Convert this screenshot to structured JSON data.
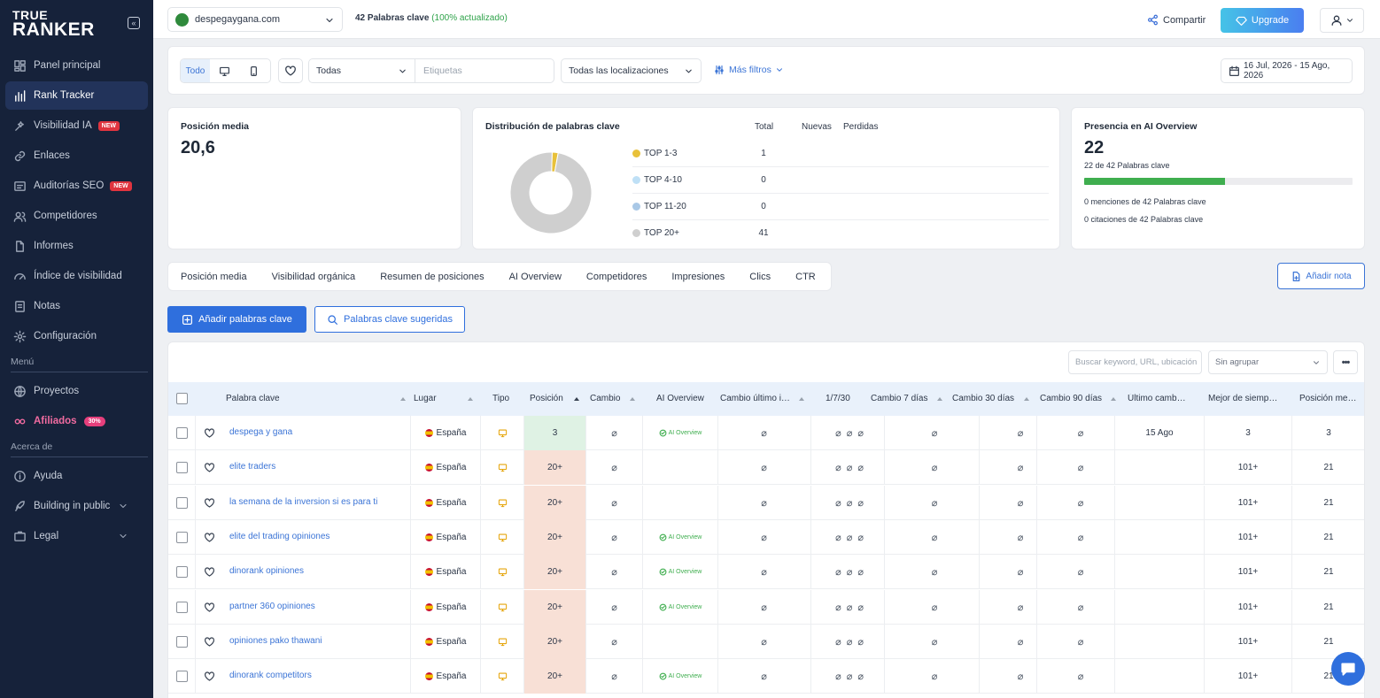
{
  "brand": {
    "line1": "TRUE",
    "line2": "RANKER"
  },
  "sidebar": {
    "items": [
      {
        "label": "Panel principal",
        "icon": "dashboard-icon"
      },
      {
        "label": "Rank Tracker",
        "icon": "bar-chart-icon",
        "active": true
      },
      {
        "label": "Visibilidad IA",
        "icon": "sparkle-icon",
        "badge": "NEW"
      },
      {
        "label": "Enlaces",
        "icon": "link-icon"
      },
      {
        "label": "Auditorías SEO",
        "icon": "audit-icon",
        "badge": "NEW"
      },
      {
        "label": "Competidores",
        "icon": "users-icon"
      },
      {
        "label": "Informes",
        "icon": "file-icon"
      },
      {
        "label": "Índice de visibilidad",
        "icon": "gauge-icon"
      },
      {
        "label": "Notas",
        "icon": "note-icon"
      },
      {
        "label": "Configuración",
        "icon": "gear-icon"
      }
    ],
    "menu_label": "Menú",
    "menu_items": [
      {
        "label": "Proyectos",
        "icon": "globe-icon"
      },
      {
        "label": "Afiliados",
        "icon": "affiliate-icon",
        "badge": "30%"
      }
    ],
    "about_label": "Acerca de",
    "about_items": [
      {
        "label": "Ayuda",
        "icon": "info-icon"
      },
      {
        "label": "Building in public",
        "icon": "rocket-icon"
      },
      {
        "label": "Legal",
        "icon": "legal-icon"
      }
    ]
  },
  "topbar": {
    "domain": "despegaygana.com",
    "keywords_count": "42 Palabras clave",
    "keywords_status": "(100% actualizado)",
    "share_label": "Compartir",
    "upgrade_label": "Upgrade"
  },
  "filters": {
    "device_all": "Todo",
    "group_select": "Todas",
    "tags_placeholder": "Etiquetas",
    "location_select": "Todas las localizaciones",
    "more_filters": "Más filtros",
    "date_range": "16 Jul, 2026 - 15 Ago, 2026"
  },
  "avg_position": {
    "title": "Posición media",
    "value": "20,6"
  },
  "distribution": {
    "title": "Distribución de palabras clave",
    "headers": [
      "Total",
      "Nuevas",
      "Perdidas"
    ],
    "rows": [
      {
        "label": "TOP 1-3",
        "total": "1",
        "color": "#e8c13a"
      },
      {
        "label": "TOP 4-10",
        "total": "0",
        "color": "#bfe0f6"
      },
      {
        "label": "TOP 11-20",
        "total": "0",
        "color": "#a9c8e6"
      },
      {
        "label": "TOP 20+",
        "total": "41",
        "color": "#cfcfcf"
      }
    ]
  },
  "chart_data": {
    "type": "pie",
    "title": "Distribución de palabras clave",
    "categories": [
      "TOP 1-3",
      "TOP 4-10",
      "TOP 11-20",
      "TOP 20+"
    ],
    "values": [
      1,
      0,
      0,
      41
    ],
    "colors": [
      "#e8c13a",
      "#bfe0f6",
      "#a9c8e6",
      "#cfcfcf"
    ]
  },
  "ai_presence": {
    "title": "Presencia en AI Overview",
    "value": "22",
    "subtitle": "22 de 42 Palabras clave",
    "fraction": 0.524,
    "mentions": "0 menciones de 42 Palabras clave",
    "citations": "0 citaciones de 42 Palabras clave"
  },
  "tabs": [
    "Posición media",
    "Visibilidad orgánica",
    "Resumen de posiciones",
    "AI Overview",
    "Competidores",
    "Impresiones",
    "Clics",
    "CTR"
  ],
  "actions": {
    "add_note": "Añadir nota",
    "add_keywords": "Añadir palabras clave",
    "suggested_keywords": "Palabras clave sugeridas"
  },
  "table": {
    "search_placeholder": "Buscar keyword, URL, ubicación",
    "group_placeholder": "Sin agrupar",
    "more": "•••",
    "columns": [
      "Palabra clave",
      "Lugar",
      "Tipo",
      "Posición",
      "Cambio",
      "AI Overview",
      "Cambio último i…",
      "1/7/30",
      "Cambio 7 días",
      "Cambio 30 días",
      "Cambio 90 días",
      "Último camb…",
      "Mejor de siemp…",
      "Posición me…"
    ],
    "null_glyph": "⌀",
    "ai_label": "AI Overview",
    "rows": [
      {
        "keyword": "despega y gana",
        "place": "España",
        "position": "3",
        "ai": true,
        "last_change": "15 Ago",
        "best": "3",
        "avg": "3"
      },
      {
        "keyword": "elite traders",
        "place": "España",
        "position": "20+",
        "ai": false,
        "last_change": "",
        "best": "101+",
        "avg": "21"
      },
      {
        "keyword": "la semana de la inversion si es para ti",
        "place": "España",
        "position": "20+",
        "ai": false,
        "last_change": "",
        "best": "101+",
        "avg": "21"
      },
      {
        "keyword": "elite del trading opiniones",
        "place": "España",
        "position": "20+",
        "ai": true,
        "last_change": "",
        "best": "101+",
        "avg": "21"
      },
      {
        "keyword": "dinorank opiniones",
        "place": "España",
        "position": "20+",
        "ai": true,
        "last_change": "",
        "best": "101+",
        "avg": "21"
      },
      {
        "keyword": "partner 360 opiniones",
        "place": "España",
        "position": "20+",
        "ai": true,
        "last_change": "",
        "best": "101+",
        "avg": "21"
      },
      {
        "keyword": "opiniones pako thawani",
        "place": "España",
        "position": "20+",
        "ai": false,
        "last_change": "",
        "best": "101+",
        "avg": "21"
      },
      {
        "keyword": "dinorank competitors",
        "place": "España",
        "position": "20+",
        "ai": true,
        "last_change": "",
        "best": "101+",
        "avg": "21"
      }
    ]
  }
}
